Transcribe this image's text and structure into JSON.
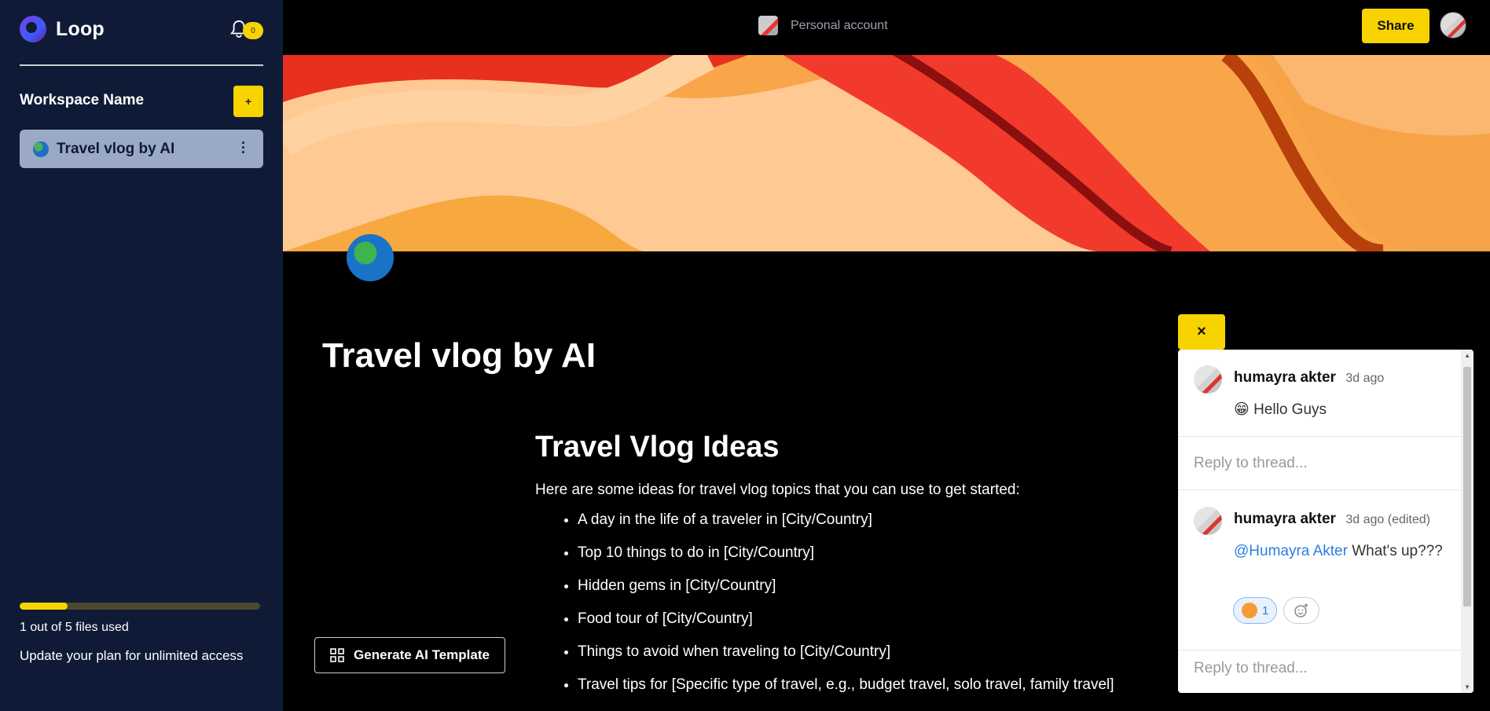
{
  "sidebar": {
    "brand": "Loop",
    "notification_count": "0",
    "workspace_name": "Workspace Name",
    "add_label": "+",
    "pages": [
      {
        "label": "Travel vlog by AI"
      }
    ],
    "storage": {
      "used": 1,
      "limit": 5,
      "fraction": 0.2,
      "text": "1 out of 5 files used"
    },
    "upgrade_text": "Update your plan for unlimited access"
  },
  "topbar": {
    "account_label": "Personal account",
    "share_label": "Share"
  },
  "document": {
    "title": "Travel vlog by AI",
    "heading": "Travel Vlog Ideas",
    "intro": "Here are some ideas for travel vlog topics that you can use to get started:",
    "ideas": [
      "A day in the life of a traveler in [City/Country]",
      "Top 10 things to do in [City/Country]",
      "Hidden gems in [City/Country]",
      "Food tour of [City/Country]",
      "Things to avoid when traveling to [City/Country]",
      "Travel tips for [Specific type of travel, e.g., budget travel, solo travel, family travel]"
    ],
    "generate_label": "Generate AI Template"
  },
  "comments": {
    "close_label": "×",
    "threads": [
      {
        "author": "humayra akter",
        "time": "3d ago",
        "emoji": "😁",
        "text": "Hello Guys"
      },
      {
        "author": "humayra akter",
        "time": "3d ago (edited)",
        "mention": "@Humayra Akter",
        "text": "What's up???",
        "reaction_count": "1"
      }
    ],
    "reply_placeholder": "Reply to thread..."
  },
  "colors": {
    "sidebar_bg": "#0f1b36",
    "accent": "#f7d300",
    "page_item_bg": "#9aa9c4",
    "mention": "#2a7de1"
  },
  "icons": [
    "loop-logo-icon",
    "bell-icon",
    "globe-icon",
    "kebab-menu-icon",
    "grid-icon",
    "close-icon",
    "add-reaction-icon"
  ]
}
